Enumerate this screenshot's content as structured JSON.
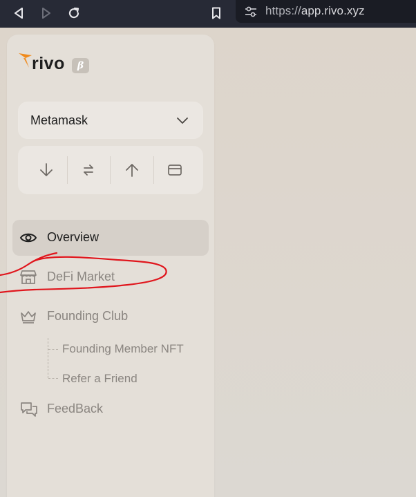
{
  "browser": {
    "back_icon": "back-arrow-icon",
    "forward_icon": "forward-arrow-icon",
    "reload_icon": "reload-icon",
    "bookmark_icon": "bookmark-icon",
    "site_settings_icon": "site-settings-icon",
    "url_scheme": "https://",
    "url_host": "app.rivo.xyz"
  },
  "brand": {
    "name": "rivo",
    "badge": "β",
    "accent": "#f08a1c"
  },
  "wallet": {
    "selected": "Metamask"
  },
  "actions": [
    {
      "icon": "arrow-down-icon"
    },
    {
      "icon": "swap-icon"
    },
    {
      "icon": "arrow-up-icon"
    },
    {
      "icon": "card-icon"
    }
  ],
  "nav": {
    "overview": {
      "label": "Overview",
      "icon": "eye-icon"
    },
    "defi_market": {
      "label": "DeFi Market",
      "icon": "store-icon"
    },
    "founding_club": {
      "label": "Founding Club",
      "icon": "crown-icon"
    },
    "founding_member_nft": {
      "label": "Founding Member NFT"
    },
    "refer_a_friend": {
      "label": "Refer a Friend"
    },
    "feedback": {
      "label": "FeedBack",
      "icon": "chat-bubbles-icon"
    }
  },
  "annotation_color": "#e0161d"
}
